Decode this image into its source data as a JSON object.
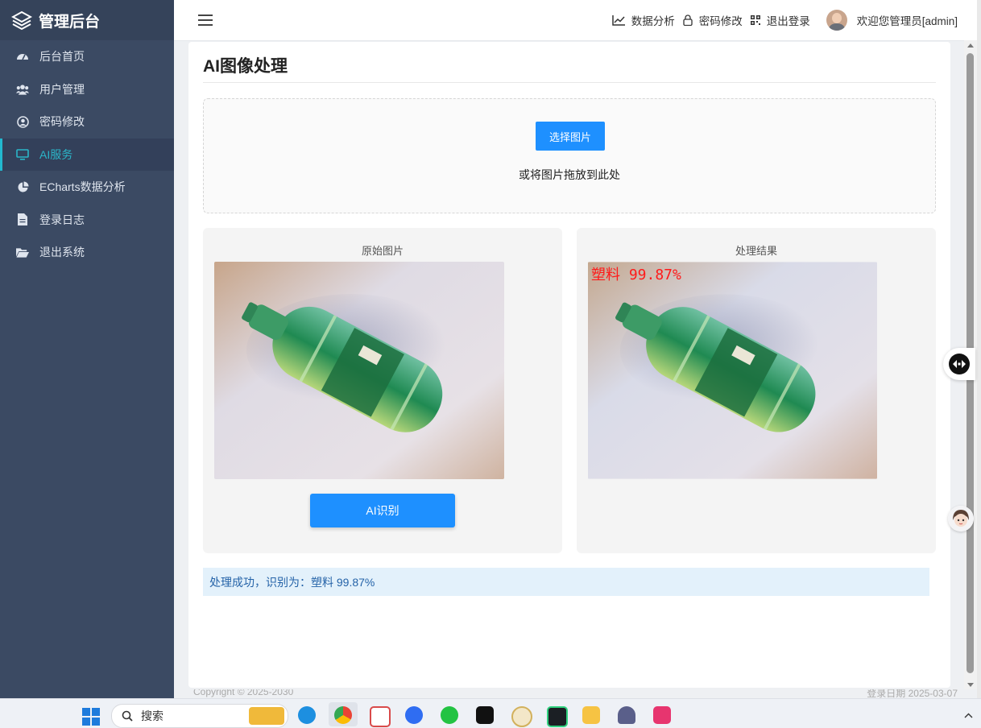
{
  "app": {
    "title": "管理后台"
  },
  "sidebar": {
    "items": [
      {
        "label": "后台首页",
        "icon": "dashboard-icon"
      },
      {
        "label": "用户管理",
        "icon": "users-icon"
      },
      {
        "label": "密码修改",
        "icon": "user-circle-icon"
      },
      {
        "label": "AI服务",
        "icon": "monitor-icon",
        "active": true
      },
      {
        "label": "ECharts数据分析",
        "icon": "pie-chart-icon"
      },
      {
        "label": "登录日志",
        "icon": "file-icon"
      },
      {
        "label": "退出系统",
        "icon": "folder-open-icon"
      }
    ]
  },
  "header": {
    "links": [
      {
        "label": "数据分析",
        "icon": "line-chart-icon"
      },
      {
        "label": "密码修改",
        "icon": "lock-icon"
      },
      {
        "label": "退出登录",
        "icon": "qrcode-icon"
      }
    ],
    "welcome": "欢迎您管理员[admin]"
  },
  "main": {
    "title": "AI图像处理",
    "upload": {
      "button_label": "选择图片",
      "hint": "或将图片拖放到此处"
    },
    "original_panel": {
      "title": "原始图片",
      "button_label": "AI识别"
    },
    "result_panel": {
      "title": "处理结果",
      "overlay_text": "塑料 99.87%"
    },
    "status_message": "处理成功，识别为：塑料 99.87%"
  },
  "footer": {
    "left": "Copyright © 2025-2030",
    "right": "登录日期 2025-03-07"
  },
  "taskbar": {
    "search_label": "搜索"
  },
  "colors": {
    "sidebar_bg": "#3b4a63",
    "accent": "#1e90ff",
    "active_text": "#2bb5c8",
    "status_bg": "#e3f1fb",
    "result_label": "#ff1a1a"
  }
}
